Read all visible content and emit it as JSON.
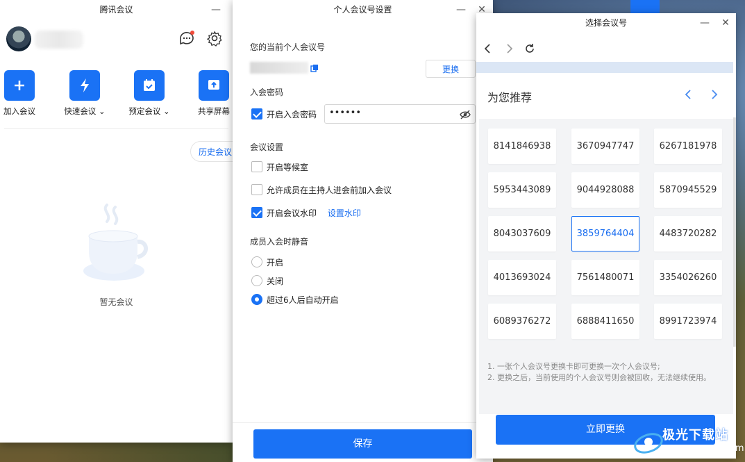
{
  "main_window": {
    "title": "腾讯会议",
    "quick_actions": [
      {
        "label": "加入会议",
        "icon": "plus-icon"
      },
      {
        "label": "快速会议",
        "icon": "lightning-icon"
      },
      {
        "label": "预定会议",
        "icon": "calendar-icon"
      },
      {
        "label": "共享屏幕",
        "icon": "share-screen-icon"
      }
    ],
    "history_button": "历史会议",
    "empty_text": "暂无会议"
  },
  "settings_window": {
    "title": "个人会议号设置",
    "current_number_label": "您的当前个人会议号",
    "change_button": "更换",
    "password_section": "入会密码",
    "enable_password_label": "开启入会密码",
    "enable_password_checked": true,
    "password_value": "••••••",
    "meeting_settings_section": "会议设置",
    "options": [
      {
        "label": "开启等候室",
        "checked": false
      },
      {
        "label": "允许成员在主持人进会前加入会议",
        "checked": false
      },
      {
        "label": "开启会议水印",
        "checked": true
      }
    ],
    "watermark_link": "设置水印",
    "mute_section": "成员入会时静音",
    "mute_options": [
      {
        "label": "开启",
        "selected": false
      },
      {
        "label": "关闭",
        "selected": false
      },
      {
        "label": "超过6人后自动开启",
        "selected": true
      }
    ],
    "save_button": "保存"
  },
  "select_window": {
    "title": "选择会议号",
    "recommend_title": "为您推荐",
    "numbers": [
      "8141846938",
      "3670947747",
      "6267181978",
      "5953443089",
      "9044928088",
      "5870945529",
      "8043037609",
      "3859764404",
      "4483720282",
      "4013693024",
      "7561480071",
      "3354026260",
      "6089376272",
      "6888411650",
      "8991723974"
    ],
    "selected_number": "3859764404",
    "note_1": "1. 一张个人会议号更换卡即可更换一次个人会议号;",
    "note_2": "2. 更换之后，当前使用的个人会议号则会被回收，无法继续使用。",
    "confirm_button": "立即更换"
  },
  "watermark": {
    "text": "极光下载站",
    "sub": "www.xz7.com"
  },
  "colors": {
    "accent": "#1a72f5",
    "link": "#1a6ef0"
  }
}
